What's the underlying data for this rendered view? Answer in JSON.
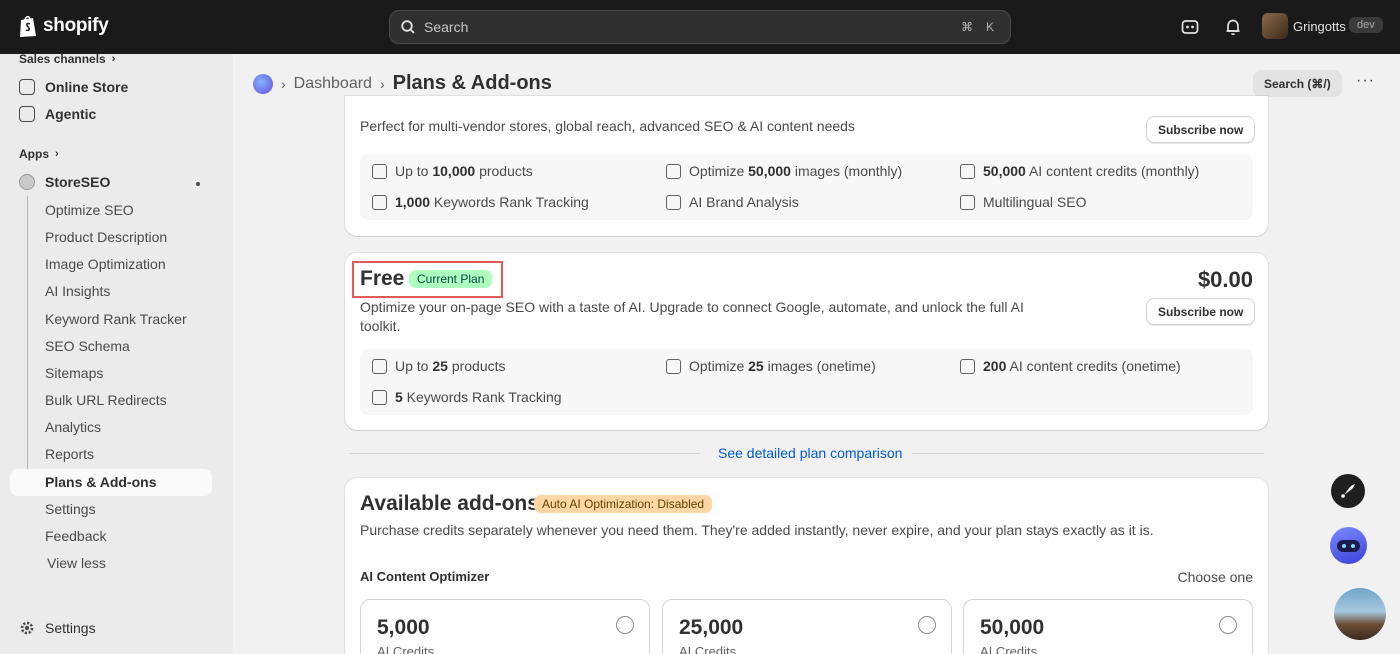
{
  "topbar": {
    "brand": "shopify",
    "search_placeholder": "Search",
    "shortcut_key1": "⌘",
    "shortcut_key2": "K",
    "store_name": "Gringotts",
    "store_badge": "dev",
    "icons": [
      "shopify-bag-icon",
      "search-icon",
      "store-icon",
      "bell-icon"
    ]
  },
  "sidebar": {
    "sales_channels": "Sales channels",
    "online_store": "Online Store",
    "agentic": "Agentic",
    "apps": "Apps",
    "app_name": "StoreSEO",
    "subitems": [
      "Optimize SEO",
      "Product Description",
      "Image Optimization",
      "AI Insights",
      "Keyword Rank Tracker",
      "SEO Schema",
      "Sitemaps",
      "Bulk URL Redirects",
      "Analytics",
      "Reports",
      "Plans & Add-ons",
      "Settings",
      "Feedback"
    ],
    "view_less": "View less",
    "settings": "Settings"
  },
  "header": {
    "breadcrumb": "Dashboard",
    "title": "Plans & Add-ons",
    "search_button": "Search (⌘/)",
    "more": "···"
  },
  "plan_top": {
    "description": "Perfect for multi-vendor stores, global reach, advanced SEO & AI content needs",
    "subscribe": "Subscribe now",
    "features": [
      {
        "pre": "Up to ",
        "bold": "10,000",
        "post": " products"
      },
      {
        "pre": "Optimize ",
        "bold": "50,000",
        "post": " images (monthly)"
      },
      {
        "pre": "",
        "bold": "50,000",
        "post": " AI content credits (monthly)"
      },
      {
        "pre": "",
        "bold": "1,000",
        "post": " Keywords Rank Tracking"
      },
      {
        "pre": "",
        "bold": "",
        "post": "AI Brand Analysis"
      },
      {
        "pre": "",
        "bold": "",
        "post": "Multilingual SEO"
      }
    ]
  },
  "plan_free": {
    "name": "Free",
    "badge": "Current Plan",
    "price": "$0.00",
    "description_line1": "Optimize your on-page SEO with a taste of AI. Upgrade to connect Google, automate, and unlock the full AI",
    "description_line2": "toolkit.",
    "subscribe": "Subscribe now",
    "features": [
      {
        "pre": "Up to ",
        "bold": "25",
        "post": " products"
      },
      {
        "pre": "Optimize ",
        "bold": "25",
        "post": " images (onetime)"
      },
      {
        "pre": "",
        "bold": "200",
        "post": " AI content credits (onetime)"
      },
      {
        "pre": "",
        "bold": "5",
        "post": " Keywords Rank Tracking"
      }
    ]
  },
  "compare_link": "See detailed plan comparison",
  "addons": {
    "title": "Available add-ons",
    "badge": "Auto AI Optimization: Disabled",
    "description": "Purchase credits separately whenever you need them. They're added instantly, never expire, and your plan stays exactly as it is.",
    "section_label": "AI Content Optimizer",
    "choose": "Choose one",
    "options": [
      {
        "value": "5,000",
        "unit": "AI Credits"
      },
      {
        "value": "25,000",
        "unit": "AI Credits"
      },
      {
        "value": "50,000",
        "unit": "AI Credits"
      }
    ]
  }
}
